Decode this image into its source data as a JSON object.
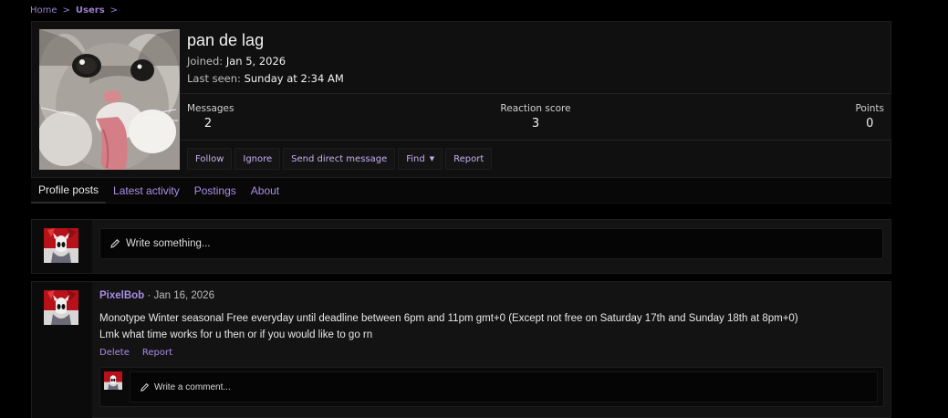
{
  "breadcrumb": {
    "home": "Home",
    "users": "Users",
    "sep": ">"
  },
  "profile": {
    "username": "pan de lag",
    "joined_label": "Joined:",
    "joined_value": "Jan 5, 2026",
    "last_seen_label": "Last seen:",
    "last_seen_value": "Sunday at 2:34 AM",
    "stats": {
      "messages_label": "Messages",
      "messages_value": "2",
      "reaction_label": "Reaction score",
      "reaction_value": "3",
      "points_label": "Points",
      "points_value": "0"
    },
    "actions": {
      "follow": "Follow",
      "ignore": "Ignore",
      "direct_message": "Send direct message",
      "find": "Find",
      "report": "Report"
    }
  },
  "tabs": [
    {
      "label": "Profile posts",
      "active": true
    },
    {
      "label": "Latest activity",
      "active": false
    },
    {
      "label": "Postings",
      "active": false
    },
    {
      "label": "About",
      "active": false
    }
  ],
  "new_post": {
    "placeholder": "Write something..."
  },
  "post": {
    "author": "PixelBob",
    "separator": "·",
    "date": "Jan 16, 2026",
    "line1": "Monotype Winter seasonal Free everyday until deadline between 6pm and 11pm gmt+0 (Except not free on Saturday 17th and Sunday 18th at 8pm+0)",
    "line2": "Lmk what time works for u then or if you would like to go rn",
    "delete_label": "Delete",
    "report_label": "Report",
    "comment_placeholder": "Write a comment..."
  },
  "colors": {
    "accent": "#a98ee4",
    "background": "#000000",
    "panel": "#131313"
  },
  "icons": {
    "pencil": "pencil-icon",
    "caret": "caret-down-icon",
    "chevron": "chevron-right-icon"
  }
}
